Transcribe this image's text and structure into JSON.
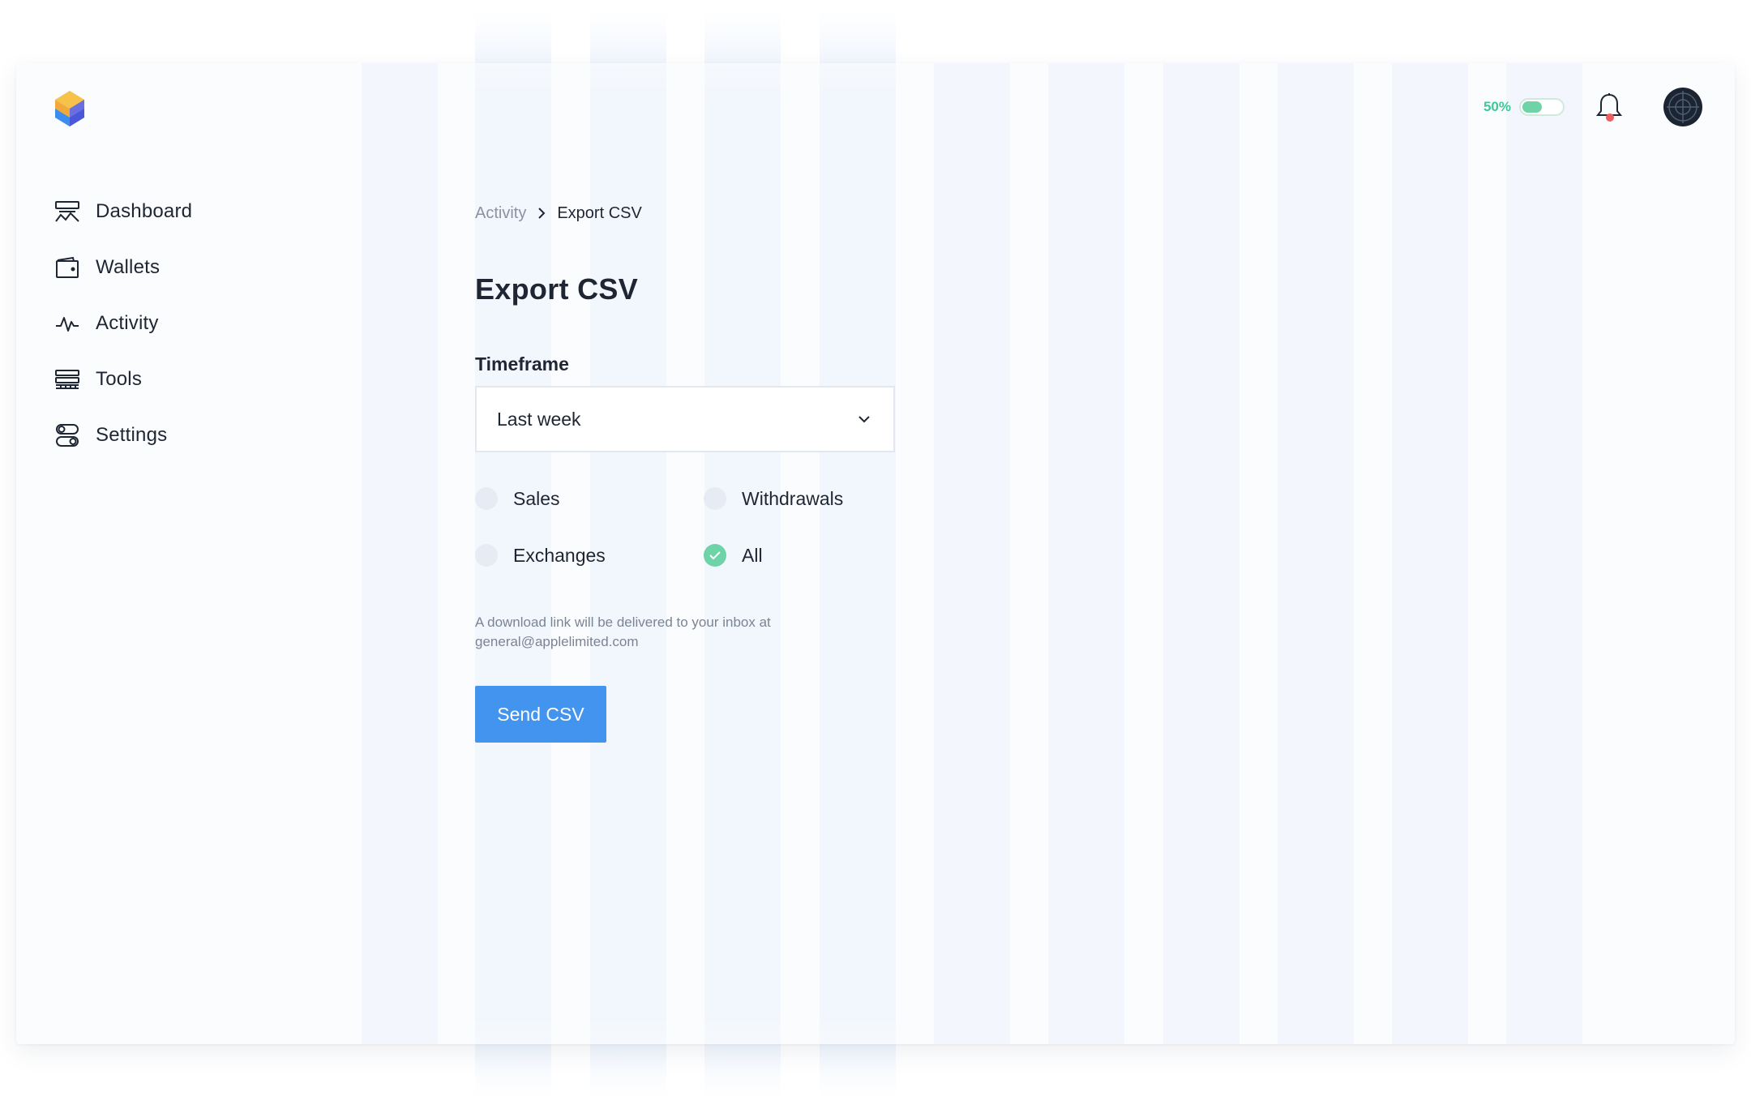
{
  "header": {
    "percent_label": "50%",
    "toggle_level": 0.5
  },
  "sidebar": {
    "items": [
      {
        "label": "Dashboard",
        "icon": "dashboard-icon"
      },
      {
        "label": "Wallets",
        "icon": "wallet-icon"
      },
      {
        "label": "Activity",
        "icon": "activity-icon"
      },
      {
        "label": "Tools",
        "icon": "tools-icon"
      },
      {
        "label": "Settings",
        "icon": "settings-icon"
      }
    ]
  },
  "breadcrumb": {
    "parent": "Activity",
    "current": "Export CSV"
  },
  "page": {
    "title": "Export CSV"
  },
  "form": {
    "timeframe_label": "Timeframe",
    "timeframe_value": "Last week",
    "options": [
      {
        "label": "Sales",
        "checked": false
      },
      {
        "label": "Withdrawals",
        "checked": false
      },
      {
        "label": "Exchanges",
        "checked": false
      },
      {
        "label": "All",
        "checked": true
      }
    ],
    "hint": "A download link will be delivered to your inbox at general@applelimited.com",
    "submit_label": "Send CSV"
  },
  "colors": {
    "accent": "#4394ef",
    "success": "#6ed3a6",
    "notification": "#f25c5c"
  }
}
